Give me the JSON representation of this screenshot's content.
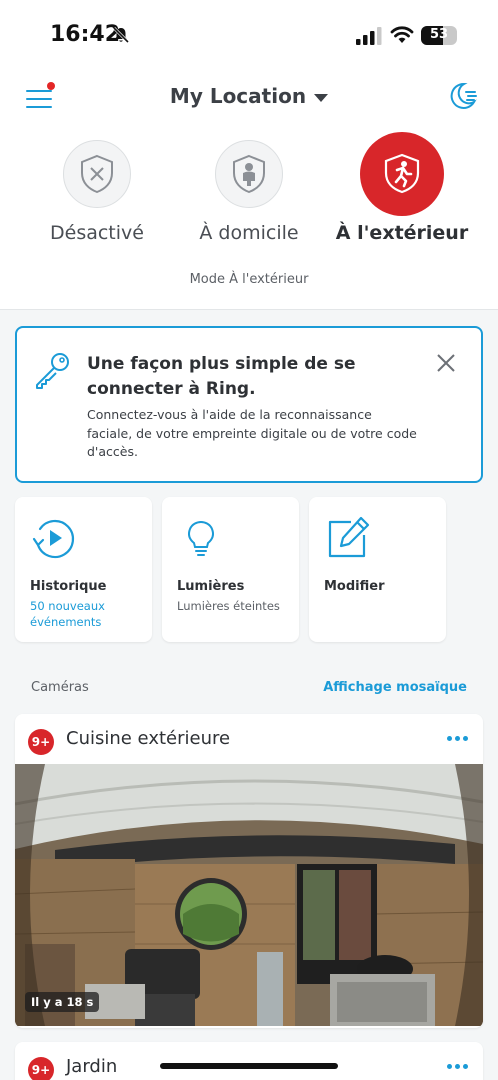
{
  "status_bar": {
    "time": "16:42",
    "battery": "53"
  },
  "header": {
    "location": "My Location"
  },
  "modes": [
    {
      "label": "Désactivé",
      "icon": "shield-x-icon",
      "active": false
    },
    {
      "label": "À domicile",
      "icon": "shield-person-icon",
      "active": false
    },
    {
      "label": "À l'extérieur",
      "icon": "shield-running-person-icon",
      "active": true
    }
  ],
  "mode_caption": "Mode À l'extérieur",
  "banner": {
    "title": "Une façon plus simple de se connecter à Ring.",
    "body": "Connectez-vous à l'aide de la reconnaissance faciale, de votre empreinte digitale ou de votre code d'accès."
  },
  "tiles": [
    {
      "name": "Historique",
      "sub": "50 nouveaux événements",
      "icon": "history-play-icon"
    },
    {
      "name": "Lumières",
      "sub": "Lumières éteintes",
      "icon": "lightbulb-icon"
    },
    {
      "name": "Modifier",
      "sub": "",
      "icon": "edit-icon"
    }
  ],
  "cameras_section": {
    "title": "Caméras",
    "mosaic_link": "Affichage mosaïque"
  },
  "cameras": [
    {
      "name": "Cuisine extérieure",
      "badge": "9+",
      "last_update": "Il y a 18 s"
    },
    {
      "name": "Jardin",
      "badge": "9+"
    }
  ],
  "colors": {
    "accent": "#1b9bd7",
    "alert": "#d8262a",
    "background": "#f4f6f7"
  }
}
